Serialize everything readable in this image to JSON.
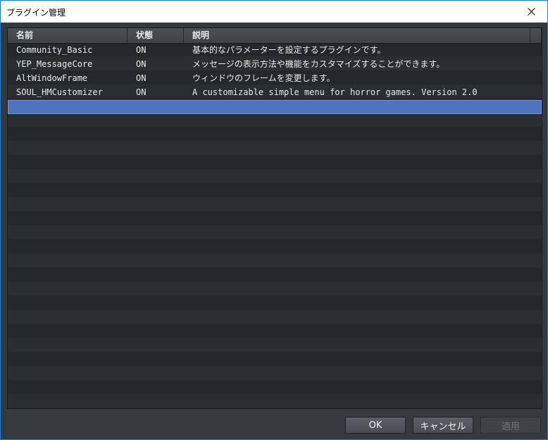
{
  "window": {
    "title": "プラグイン管理"
  },
  "table": {
    "headers": [
      "名前",
      "状態",
      "説明"
    ],
    "rows": [
      {
        "name": "Community_Basic",
        "status": "ON",
        "description": "基本的なパラメーターを設定するプラグインです。"
      },
      {
        "name": "YEP_MessageCore",
        "status": "ON",
        "description": "メッセージの表示方法や機能をカスタマイズすることができます。"
      },
      {
        "name": "AltWindowFrame",
        "status": "ON",
        "description": "ウィンドウのフレームを変更します。"
      },
      {
        "name": "SOUL_HMCustomizer",
        "status": "ON",
        "description": "A customizable simple menu for horror games. Version 2.0"
      },
      {
        "name": "",
        "status": "",
        "description": ""
      }
    ],
    "selected_row": 4
  },
  "buttons": {
    "ok": "OK",
    "cancel": "キャンセル",
    "apply": "適用"
  },
  "colors": {
    "selection": "#4f73be",
    "background": "#353a3e",
    "border": "#1f7ad1"
  }
}
